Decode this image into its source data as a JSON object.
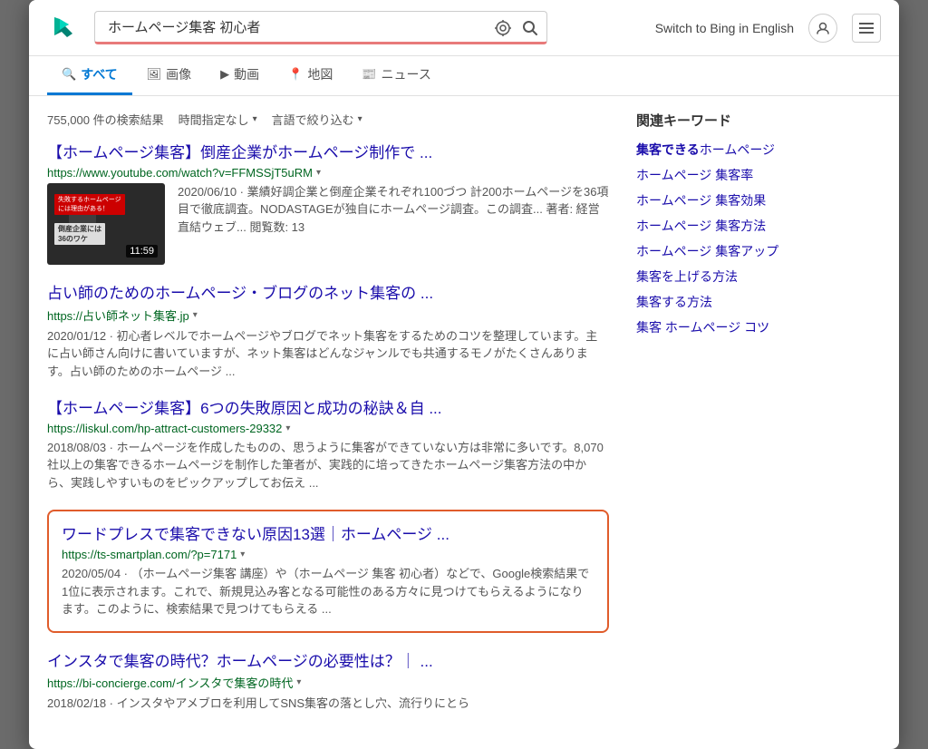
{
  "header": {
    "search_query": "ホームページ集客 初心者",
    "switch_bing_label": "Switch to Bing in English"
  },
  "nav": {
    "tabs": [
      {
        "id": "all",
        "label": "すべて",
        "icon": "search",
        "active": true
      },
      {
        "id": "images",
        "label": "画像",
        "icon": "image",
        "active": false
      },
      {
        "id": "video",
        "label": "動画",
        "icon": "video",
        "active": false
      },
      {
        "id": "map",
        "label": "地図",
        "icon": "map",
        "active": false
      },
      {
        "id": "news",
        "label": "ニュース",
        "icon": "news",
        "active": false
      }
    ]
  },
  "search_meta": {
    "count": "755,000 件の検索結果",
    "filter1": "時間指定なし",
    "filter2": "言語で絞り込む"
  },
  "results": [
    {
      "id": "r1",
      "title": "【ホームページ集客】倒産企業がホームページ制作で ...",
      "url": "https://www.youtube.com/watch?v=FFMSSjT5uRM",
      "has_dropdown": true,
      "has_thumb": true,
      "thumb_duration": "11:59",
      "thumb_desc1": "失敗するホームページ",
      "thumb_desc2": "には理由がある！",
      "thumb_sub": "倒産企業には",
      "thumb_badge": "36のワケ",
      "desc": "2020/06/10 · 業績好調企業と倒産企業それぞれ100づつ 計200ホームページを36項目で徹底調査。NODASTAGEが独自にホームページ調査。この調査... 著者: 経営直結ウェブ... 閲覧数: 13",
      "highlighted": false
    },
    {
      "id": "r2",
      "title": "占い師のためのホームページ・ブログのネット集客の ...",
      "url": "https://占い師ネット集客.jp",
      "has_dropdown": true,
      "has_thumb": false,
      "desc": "2020/01/12 · 初心者レベルでホームページやブログでネット集客をするためのコツを整理しています。主に占い師さん向けに書いていますが、ネット集客はどんなジャンルでも共通するモノがたくさんあります。占い師のためのホームページ ...",
      "highlighted": false
    },
    {
      "id": "r3",
      "title": "【ホームページ集客】6つの失敗原因と成功の秘訣＆自 ...",
      "url": "https://liskul.com/hp-attract-customers-29332",
      "has_dropdown": true,
      "has_thumb": false,
      "desc": "2018/08/03 · ホームページを作成したものの、思うように集客ができていない方は非常に多いです。8,070社以上の集客できるホームページを制作した筆者が、実践的に培ってきたホームページ集客方法の中から、実践しやすいものをピックアップしてお伝え ...",
      "highlighted": false
    },
    {
      "id": "r4",
      "title": "ワードプレスで集客できない原因13選｜ホームページ ...",
      "url": "https://ts-smartplan.com/?p=7171",
      "has_dropdown": true,
      "has_thumb": false,
      "desc": "2020/05/04 · （ホームページ集客 講座）や（ホームページ 集客 初心者）などで、Google検索結果で1位に表示されます。これで、新規見込み客となる可能性のある方々に見つけてもらえるようになります。このように、検索結果で見つけてもらえる ...",
      "highlighted": true
    },
    {
      "id": "r5",
      "title": "インスタで集客の時代？ホームページの必要性は？｜ ...",
      "url": "https://bi-concierge.com/インスタで集客の時代",
      "has_dropdown": true,
      "has_thumb": false,
      "desc": "2018/02/18 · インスタやアメブロを利用してSNS集客の落とし穴、流行りにとら",
      "highlighted": false
    }
  ],
  "sidebar": {
    "title": "関連キーワード",
    "keywords": [
      {
        "text": "集客できる",
        "bold": "集客できる",
        "suffix": "ホームページ"
      },
      {
        "text": "ホームページ 集客率",
        "bold": "",
        "suffix": ""
      },
      {
        "text": "ホームページ 集客効果",
        "bold": "",
        "suffix": ""
      },
      {
        "text": "ホームページ 集客方法",
        "bold": "",
        "suffix": ""
      },
      {
        "text": "ホームページ 集客アップ",
        "bold": "",
        "suffix": ""
      },
      {
        "text": "集客を上げる方法",
        "bold": "",
        "suffix": ""
      },
      {
        "text": "集客する方法",
        "bold": "",
        "suffix": ""
      },
      {
        "text": "集客 ホームページ コツ",
        "bold": "",
        "suffix": ""
      }
    ]
  }
}
